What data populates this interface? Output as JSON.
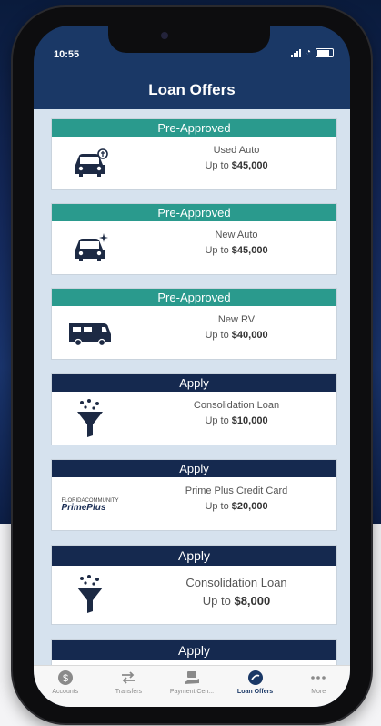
{
  "status": {
    "time": "10:55"
  },
  "header": {
    "title": "Loan Offers"
  },
  "offers": [
    {
      "badge": "Pre-Approved",
      "name": "Used Auto",
      "amount_prefix": "Up to",
      "amount": "$45,000"
    },
    {
      "badge": "Pre-Approved",
      "name": "New Auto",
      "amount_prefix": "Up to",
      "amount": "$45,000"
    },
    {
      "badge": "Pre-Approved",
      "name": "New RV",
      "amount_prefix": "Up to",
      "amount": "$40,000"
    },
    {
      "badge": "Apply",
      "name": "Consolidation Loan",
      "amount_prefix": "Up to",
      "amount": "$10,000"
    },
    {
      "badge": "Apply",
      "name": "Prime Plus Credit Card",
      "amount_prefix": "Up to",
      "amount": "$20,000",
      "logo_small": "FLORIDACOMMUNITY",
      "logo_big": "PrimePlus"
    },
    {
      "badge": "Apply",
      "name": "Consolidation Loan",
      "amount_prefix": "Up to",
      "amount": "$8,000"
    },
    {
      "badge": "Apply"
    }
  ],
  "tabs": [
    {
      "label": "Accounts",
      "icon": "dollar-circle-icon"
    },
    {
      "label": "Transfers",
      "icon": "transfer-arrows-icon"
    },
    {
      "label": "Payment Cen...",
      "icon": "payment-hand-icon"
    },
    {
      "label": "Loan Offers",
      "icon": "loan-offers-icon",
      "active": true
    },
    {
      "label": "More",
      "icon": "more-dots-icon"
    }
  ],
  "colors": {
    "teal_badge": "#2a9a8d",
    "navy_badge": "#15294f",
    "header": "#1a3866",
    "content_bg": "#d6e2ee"
  }
}
